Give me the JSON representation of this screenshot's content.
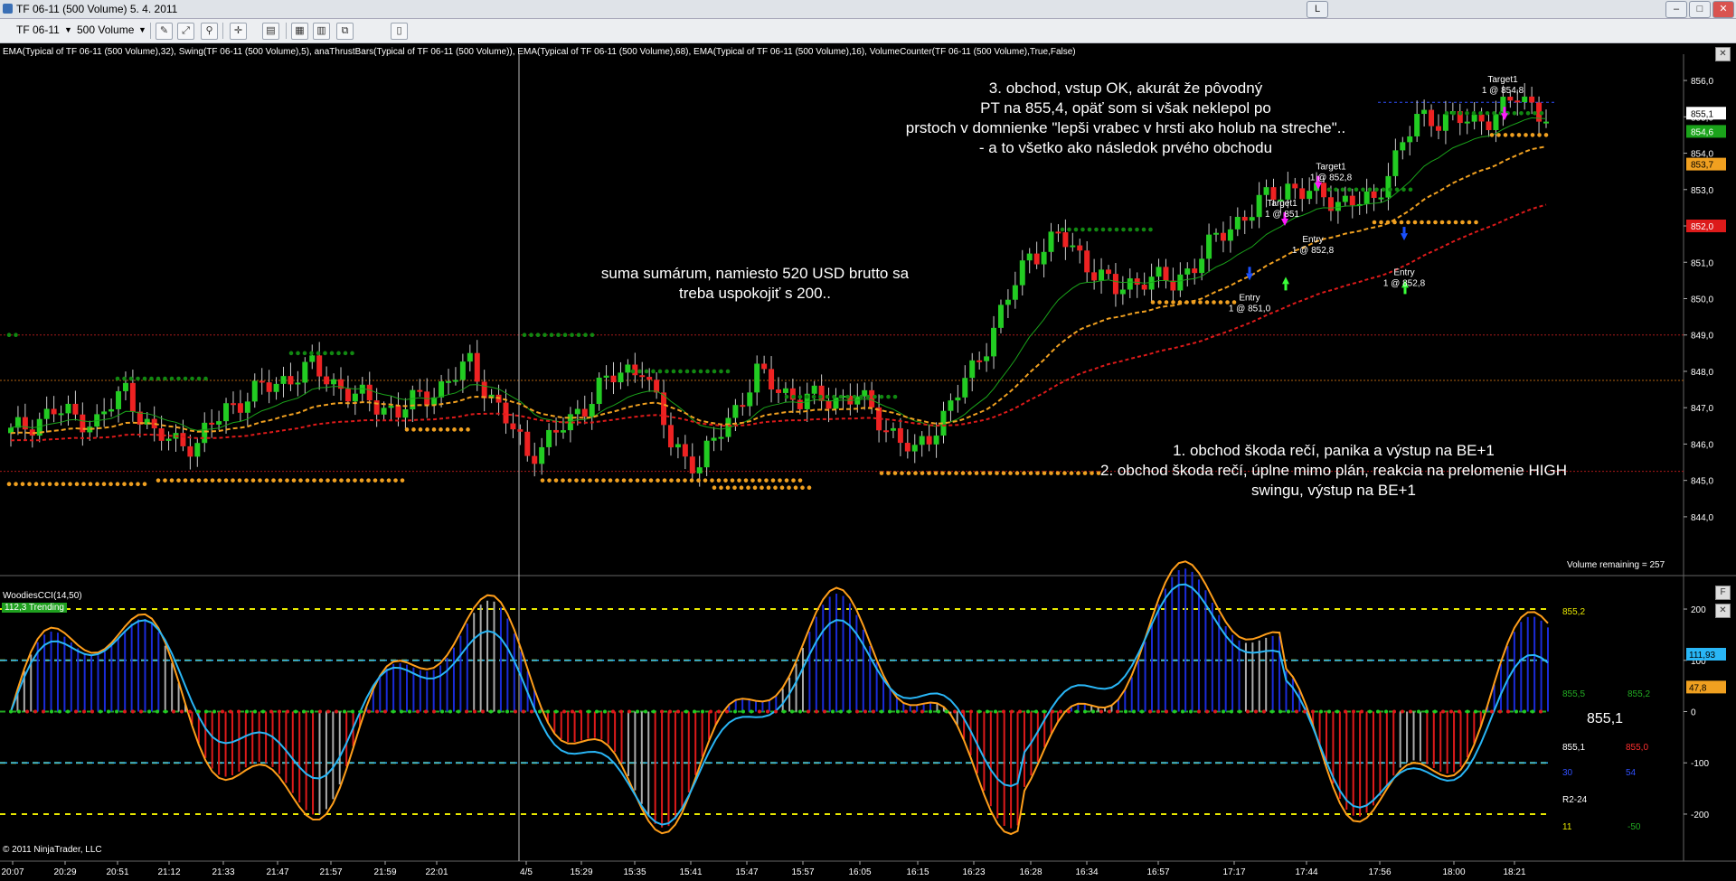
{
  "window": {
    "title": "TF 06-11 (500 Volume)  5. 4. 2011",
    "btn_l": "L"
  },
  "toolbar": {
    "instrument": "TF 06-11",
    "period": "500 Volume"
  },
  "indicators_line": "EMA(Typical of TF 06-11 (500 Volume),32), Swing(TF 06-11 (500 Volume),5), anaThrustBars(Typical of TF 06-11 (500 Volume)), EMA(Typical of TF 06-11 (500 Volume),68), EMA(Typical of TF 06-11 (500 Volume),16), VolumeCounter(TF 06-11 (500 Volume),True,False)",
  "notes": {
    "note3": [
      "3. obchod, vstup OK, akurát že pôvodný",
      "PT na 855,4, opäť som si však neklepol po",
      "prstoch v domnienke \"lepši vrabec v hrsti ako holub na streche\"..",
      "- a to všetko ako následok prvého obchodu"
    ],
    "suma": [
      "suma sumárum, namiesto 520 USD brutto sa",
      "treba uspokojiť s 200.."
    ],
    "note12": [
      "1. obchod škoda rečí, panika a výstup na BE+1",
      "2. obchod škoda rečí, úplne mimo plán, reakcia na prelomenie HIGH",
      "swingu, výstup na BE+1"
    ]
  },
  "trade_labels": {
    "target1a": [
      "Target1",
      "1 @ 851"
    ],
    "target1b": [
      "Target1",
      "1 @ 852,8"
    ],
    "target1c": [
      "Target1",
      "1 @ 854,8"
    ],
    "entry1": [
      "Entry",
      "1 @ 851,0"
    ],
    "entry2": [
      "Entry",
      "1 @ 852,8"
    ],
    "entry3": [
      "Entry",
      "1 @ 852,8"
    ]
  },
  "price_axis": {
    "ticks": [
      "856,0",
      "855,0",
      "854,0",
      "853,0",
      "852,0",
      "851,0",
      "850,0",
      "849,0",
      "848,0",
      "847,0",
      "846,0",
      "845,0",
      "844,0"
    ],
    "tags": [
      {
        "text": "855,1",
        "color": "#ffffff",
        "textcolor": "#000000"
      },
      {
        "text": "854,6",
        "color": "#1aa31a",
        "textcolor": "#ffffff"
      },
      {
        "text": "853,7",
        "color": "#f0a020",
        "textcolor": "#000000"
      },
      {
        "text": "852,0",
        "color": "#dd1a1a",
        "textcolor": "#ffffff"
      }
    ]
  },
  "volume_remaining": "Volume remaining = 257",
  "cci": {
    "title": "WoodiesCCI(14,50)",
    "trend": "112,3 Trending",
    "ticks": [
      "200",
      "100",
      "0",
      "-100",
      "-200"
    ],
    "tags": [
      {
        "text": "111,93",
        "color": "#29b6f6",
        "textcolor": "#000000"
      },
      {
        "text": "47,8",
        "color": "#f0a020",
        "textcolor": "#000000"
      }
    ],
    "side_values": [
      {
        "text": "855,2",
        "color": "#e8e800"
      },
      {
        "text": "855,5",
        "color": "#22aa22"
      },
      {
        "text": "855,2",
        "color": "#22aa22"
      },
      {
        "text": "855,1",
        "color": "#ffffff"
      },
      {
        "text": "855,1",
        "color": "#ffffff"
      },
      {
        "text": "855,0",
        "color": "#ff3030"
      },
      {
        "text": "30",
        "color": "#3050ff"
      },
      {
        "text": "54",
        "color": "#3050ff"
      },
      {
        "text": "R2-24",
        "color": "#ffffff"
      },
      {
        "text": "11",
        "color": "#e8e800"
      },
      {
        "text": "-50",
        "color": "#22aa22"
      }
    ]
  },
  "time_axis": [
    "20:07",
    "20:29",
    "20:51",
    "21:12",
    "21:33",
    "21:47",
    "21:57",
    "21:59",
    "22:01",
    "4/5",
    "15:29",
    "15:35",
    "15:41",
    "15:47",
    "15:57",
    "16:05",
    "16:15",
    "16:23",
    "16:28",
    "16:34",
    "16:57",
    "17:17",
    "17:44",
    "17:56",
    "18:00",
    "18:21"
  ],
  "copyright": "© 2011 NinjaTrader, LLC",
  "colors": {
    "up": "#22cc22",
    "down": "#ee2222",
    "ema16": "#1aa31a",
    "ema32": "#f0a020",
    "ema68": "#dd1a1a",
    "swing_high": "#118811",
    "swing_low": "#f0a020",
    "cci": "#ff9e1a",
    "tcci": "#29b6f6"
  }
}
